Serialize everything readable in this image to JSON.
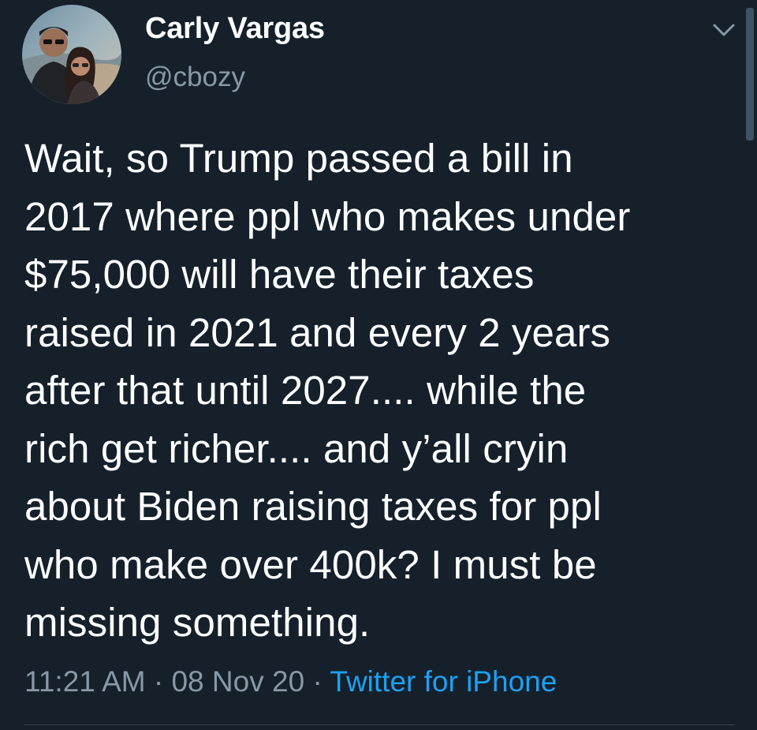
{
  "user": {
    "display_name": "Carly Vargas",
    "handle": "@cbozy",
    "avatar_icon": "profile-photo"
  },
  "tweet": {
    "text": "Wait, so Trump passed a bill in\n2017 where ppl who makes under\n$75,000 will have their taxes\nraised in 2021 and every 2 years\nafter that until 2027.... while the\nrich get richer.... and y’all cryin\nabout Biden raising taxes for ppl\nwho make over 400k? I must be\nmissing something.",
    "time": "11:21 AM",
    "separator": "·",
    "date": "08 Nov 20",
    "source": "Twitter for iPhone"
  },
  "icons": {
    "menu": "chevron-down-icon"
  },
  "colors": {
    "background": "#15202b",
    "text": "#ffffff",
    "secondary_text": "#8899a6",
    "link": "#1da1f2"
  }
}
